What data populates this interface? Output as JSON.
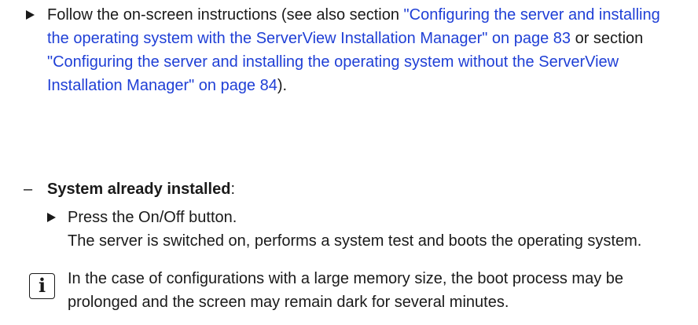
{
  "step1": {
    "prefix": "Follow the on-screen instructions (see also section ",
    "link1": "\"Configuring the server and installing the operating system with the ServerView Installation Manager\" on page 83",
    "middle": " or section ",
    "link2": "\"Configuring the server and installing the operating system without the ServerView Installation Manager\" on page 84",
    "suffix": ")."
  },
  "dash_item": {
    "dash": "–",
    "label": "System already installed",
    "colon": ":"
  },
  "step2": {
    "instruction": "Press the On/Off button.",
    "result": "The server is switched on, performs a system test and boots the operating system."
  },
  "note": {
    "icon": "info-icon",
    "icon_glyph": "i",
    "text": "In the case of configurations with a large memory size, the boot process may be prolonged and the screen may remain dark for several minutes."
  },
  "colors": {
    "link": "#1f3fd6",
    "text": "#1a1a1a"
  }
}
